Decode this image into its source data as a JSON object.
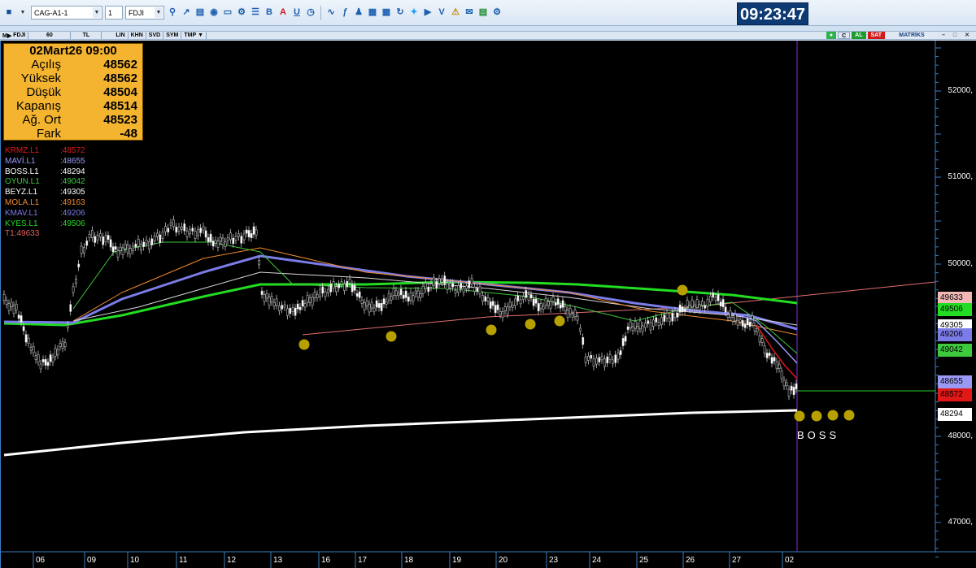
{
  "toolbar": {
    "symbol_select": "CAG-A1-1",
    "count_select": "1",
    "ticker_select": "FDJI",
    "icons": [
      "search-icon",
      "cursor-icon",
      "chart-type-icon",
      "globe-icon",
      "monitor-icon",
      "settings-icon",
      "list-icon",
      "bold-icon",
      "text-color-icon",
      "underline-icon",
      "clock-icon",
      "chart-line-icon",
      "function-icon",
      "users-icon",
      "calculator-icon",
      "table-icon",
      "refresh-icon",
      "twitter-icon",
      "video-icon",
      "news-icon",
      "alert-icon",
      "mail-icon",
      "export-icon",
      "gear-icon"
    ]
  },
  "clock": "09:23:47",
  "chart_header": {
    "symbol": "FDJI",
    "period": "60",
    "currency": "TL",
    "modes": [
      "LIN",
      "KHN",
      "SVD",
      "SYM",
      "TMP"
    ],
    "buy_label": "AL",
    "sell_label": "SAT",
    "brand": "MATRİKS"
  },
  "info_panel": {
    "date": "02Mart26 09:00",
    "rows": [
      {
        "label": "Açılış",
        "value": "48562"
      },
      {
        "label": "Yüksek",
        "value": "48562"
      },
      {
        "label": "Düşük",
        "value": "48504"
      },
      {
        "label": "Kapanış",
        "value": "48514"
      },
      {
        "label": "Ağ. Ort",
        "value": "48523"
      },
      {
        "label": "Fark",
        "value": "-48"
      }
    ]
  },
  "legend": [
    {
      "name": "KRMZ.L1",
      "value": ":48572",
      "color": "#e01818"
    },
    {
      "name": "MAVİ.L1",
      "value": ":48655",
      "color": "#9a9af5"
    },
    {
      "name": "BOSS.L1",
      "value": ":48294",
      "color": "#ffffff"
    },
    {
      "name": "OYUN.L1",
      "value": ":49042",
      "color": "#3ec83e"
    },
    {
      "name": "BEYZ.L1",
      "value": ":49305",
      "color": "#ffffff"
    },
    {
      "name": "MOLA.L1",
      "value": ":49163",
      "color": "#f08a2c"
    },
    {
      "name": "KMAV.L1",
      "value": ":49206",
      "color": "#7c7ce8"
    },
    {
      "name": "KYES.L1",
      "value": ":49506",
      "color": "#22dd22"
    },
    {
      "name": "T1:49633",
      "value": "",
      "color": "#e06060"
    }
  ],
  "price_axis": [
    "52000,",
    "51000,",
    "50000,",
    "49000,",
    "48000,",
    "47000,"
  ],
  "price_tags": [
    {
      "value": "49633",
      "bg": "#f2b8b8",
      "color": "#000"
    },
    {
      "value": "49506",
      "bg": "#22dd22",
      "color": "#000"
    },
    {
      "value": "49305",
      "bg": "#ffffff",
      "color": "#000"
    },
    {
      "value": "49206",
      "bg": "#7c7ce8",
      "color": "#000"
    },
    {
      "value": "49042",
      "bg": "#3ec83e",
      "color": "#000"
    },
    {
      "value": "48655",
      "bg": "#9a9af5",
      "color": "#000"
    },
    {
      "value": "48572",
      "bg": "#e01818",
      "color": "#000"
    },
    {
      "value": "48294",
      "bg": "#ffffff",
      "color": "#000"
    }
  ],
  "date_axis": [
    "06",
    "09",
    "10",
    "11",
    "12",
    "13",
    "16",
    "17",
    "18",
    "19",
    "20",
    "23",
    "24",
    "25",
    "26",
    "27",
    "02"
  ],
  "annotation": {
    "text": "BOSS"
  },
  "colors": {
    "background": "#000000",
    "krmz": "#e01818",
    "mavi": "#9a9af5",
    "boss": "#ffffff",
    "oyun": "#3ec83e",
    "mola": "#f08a2c",
    "kmav": "#7c7ce8",
    "kyes": "#22dd22",
    "trend": "#e07070",
    "marker": "#b8a000",
    "cursor_line": "#8a2be2",
    "clock_bg": "#0e3a73"
  }
}
